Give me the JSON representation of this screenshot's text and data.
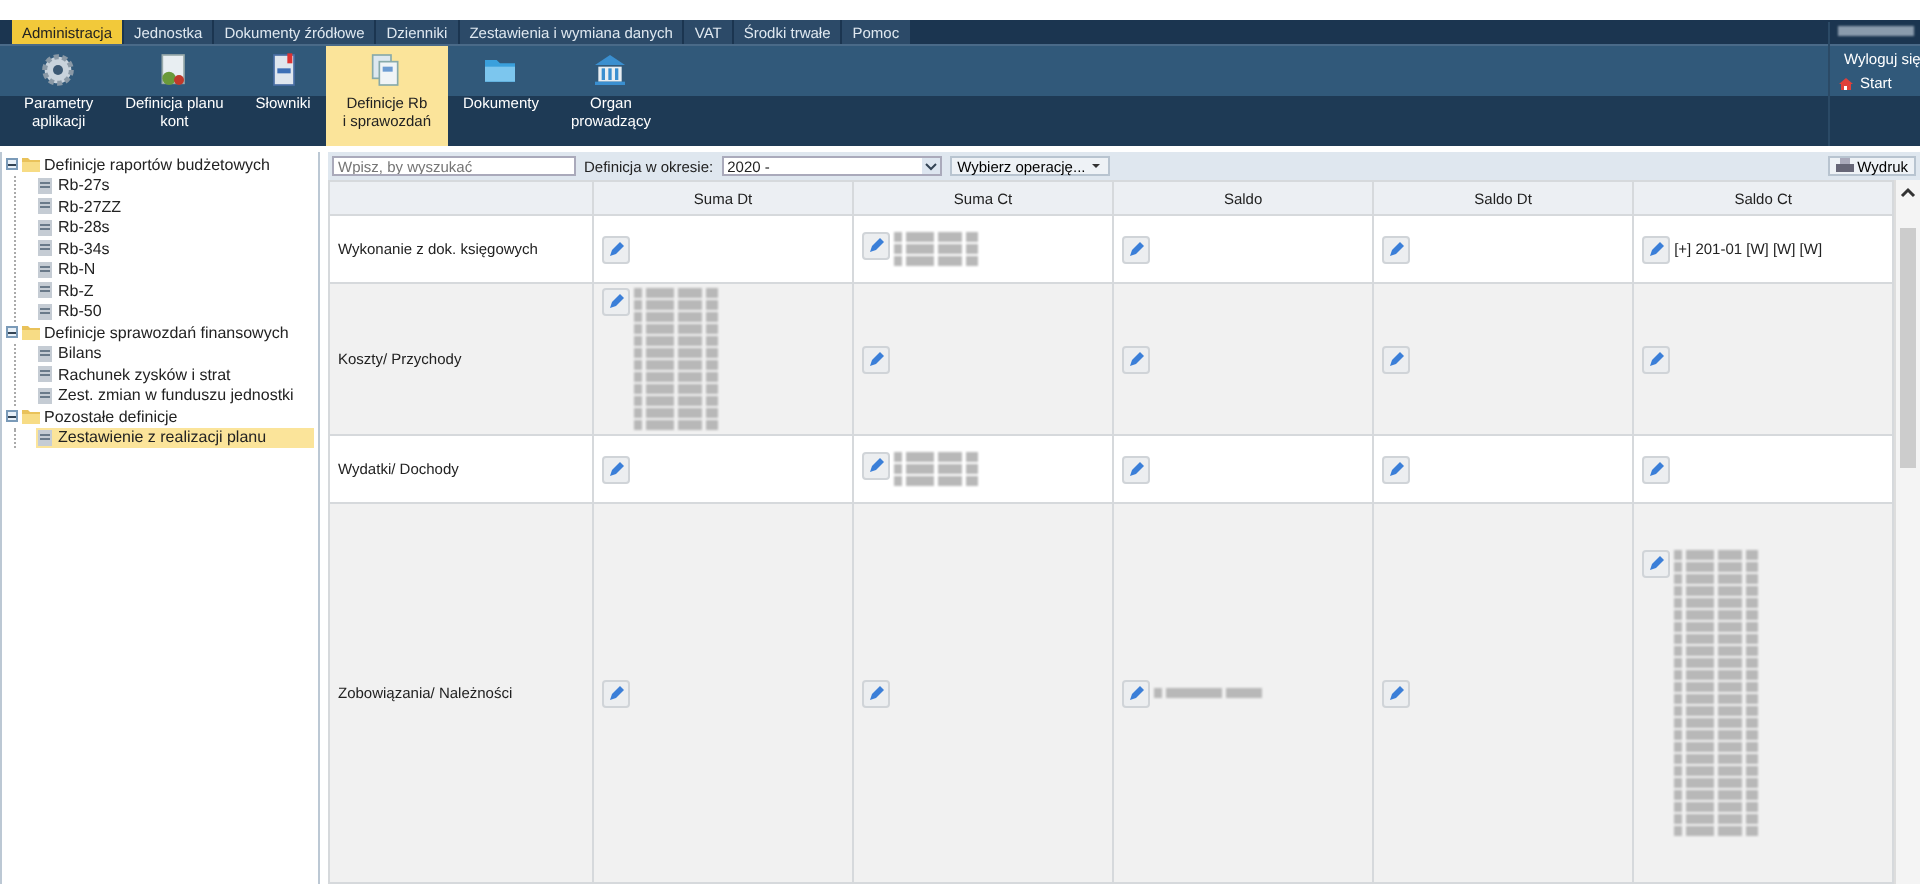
{
  "menu_tabs": [
    {
      "label": "Administracja",
      "selected": true
    },
    {
      "label": "Jednostka",
      "selected": false
    },
    {
      "label": "Dokumenty źródłowe",
      "selected": false
    },
    {
      "label": "Dzienniki",
      "selected": false
    },
    {
      "label": "Zestawienia i wymiana danych",
      "selected": false
    },
    {
      "label": "VAT",
      "selected": false
    },
    {
      "label": "Środki trwałe",
      "selected": false
    },
    {
      "label": "Pomoc",
      "selected": false
    }
  ],
  "ribbon": [
    {
      "label": "Parametry\naplikacji",
      "selected": false
    },
    {
      "label": "Definicja planu\nkont",
      "selected": false
    },
    {
      "label": "Słowniki",
      "selected": false
    },
    {
      "label": "Definicje Rb\ni sprawozdań",
      "selected": true
    },
    {
      "label": "Dokumenty",
      "selected": false
    },
    {
      "label": "Organ\nprowadzący",
      "selected": false
    }
  ],
  "user_links": [
    {
      "label": "Wyloguj się"
    },
    {
      "label": "Start"
    }
  ],
  "tree": [
    {
      "label": "Definicje raportów budżetowych",
      "expanded": true,
      "selected": false,
      "children": [
        {
          "label": "Rb-27s",
          "selected": false
        },
        {
          "label": "Rb-27ZZ",
          "selected": false
        },
        {
          "label": "Rb-28s",
          "selected": false
        },
        {
          "label": "Rb-34s",
          "selected": false
        },
        {
          "label": "Rb-N",
          "selected": false
        },
        {
          "label": "Rb-Z",
          "selected": false
        },
        {
          "label": "Rb-50",
          "selected": false
        }
      ]
    },
    {
      "label": "Definicje sprawozdań finansowych",
      "expanded": true,
      "selected": false,
      "children": [
        {
          "label": "Bilans",
          "selected": false
        },
        {
          "label": "Rachunek zysków i strat",
          "selected": false
        },
        {
          "label": "Zest. zmian w funduszu jednostki",
          "selected": false
        }
      ]
    },
    {
      "label": "Pozostałe definicje",
      "expanded": true,
      "selected": false,
      "children": [
        {
          "label": "Zestawienie z realizacji planu",
          "selected": true
        }
      ]
    }
  ],
  "toolbar": {
    "search": {
      "placeholder": "Wpisz, by wyszukać"
    },
    "period_label": "Definicja w okresie:",
    "period_value": "2020 -",
    "operation_button": "Wybierz operację...",
    "print_button": "Wydruk"
  },
  "table": {
    "columns": [
      "Suma Dt",
      "Suma Ct",
      "Saldo",
      "Saldo Dt",
      "Saldo Ct"
    ],
    "rows": [
      {
        "label": "Wykonanie z dok. księgowych",
        "cells": [
          {
            "kind": "empty"
          },
          {
            "kind": "blurblock"
          },
          {
            "kind": "empty"
          },
          {
            "kind": "empty"
          },
          {
            "kind": "text",
            "text": "[+] 201-01 [W] [W] [W]"
          }
        ]
      },
      {
        "label": "Koszty/ Przychody",
        "cells": [
          {
            "kind": "blurlist"
          },
          {
            "kind": "empty"
          },
          {
            "kind": "empty"
          },
          {
            "kind": "empty"
          },
          {
            "kind": "empty"
          }
        ]
      },
      {
        "label": "Wydatki/ Dochody",
        "cells": [
          {
            "kind": "empty"
          },
          {
            "kind": "blurblock"
          },
          {
            "kind": "empty"
          },
          {
            "kind": "empty"
          },
          {
            "kind": "empty"
          }
        ]
      },
      {
        "label": "Zobowiązania/ Należności",
        "cells": [
          {
            "kind": "empty"
          },
          {
            "kind": "empty"
          },
          {
            "kind": "blurline"
          },
          {
            "kind": "empty"
          },
          {
            "kind": "blurcolumn"
          }
        ]
      }
    ]
  }
}
